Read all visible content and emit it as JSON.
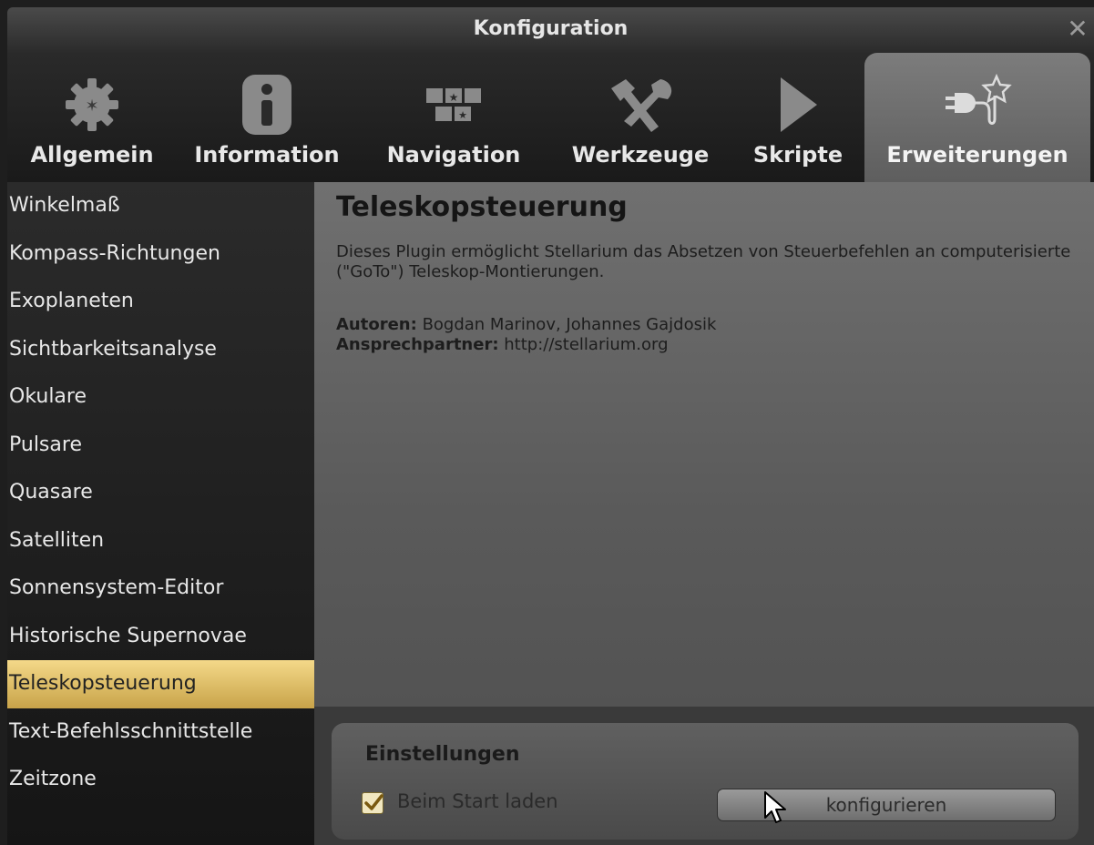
{
  "window": {
    "title": "Konfiguration",
    "close_glyph": "✕"
  },
  "tabs": [
    {
      "label": "Allgemein",
      "icon": "gear-icon"
    },
    {
      "label": "Information",
      "icon": "info-icon"
    },
    {
      "label": "Navigation",
      "icon": "navigation-icon"
    },
    {
      "label": "Werkzeuge",
      "icon": "tools-icon"
    },
    {
      "label": "Skripte",
      "icon": "play-icon"
    },
    {
      "label": "Erweiterungen",
      "icon": "plugin-icon",
      "active": true
    }
  ],
  "sidebar": {
    "items": [
      "Winkelmaß",
      "Kompass-Richtungen",
      "Exoplaneten",
      "Sichtbarkeitsanalyse",
      "Okulare",
      "Pulsare",
      "Quasare",
      "Satelliten",
      "Sonnensystem-Editor",
      "Historische Supernovae",
      "Teleskopsteuerung",
      "Text-Befehlsschnittstelle",
      "Zeitzone"
    ],
    "selected": "Teleskopsteuerung"
  },
  "plugin": {
    "title": "Teleskopsteuerung",
    "description": "Dieses Plugin ermöglicht Stellarium das Absetzen von Steuerbefehlen an computerisierte (\"GoTo\") Teleskop-Montierungen.",
    "authors_label": "Autoren:",
    "authors": "Bogdan Marinov, Johannes Gajdosik",
    "contact_label": "Ansprechpartner:",
    "contact": "http://stellarium.org"
  },
  "settings": {
    "title": "Einstellungen",
    "load_at_startup_label": "Beim Start laden",
    "load_at_startup_checked": true,
    "configure_button": "konfigurieren"
  },
  "colors": {
    "accent": "#e0bd6a",
    "panel": "#5e5e5e"
  }
}
